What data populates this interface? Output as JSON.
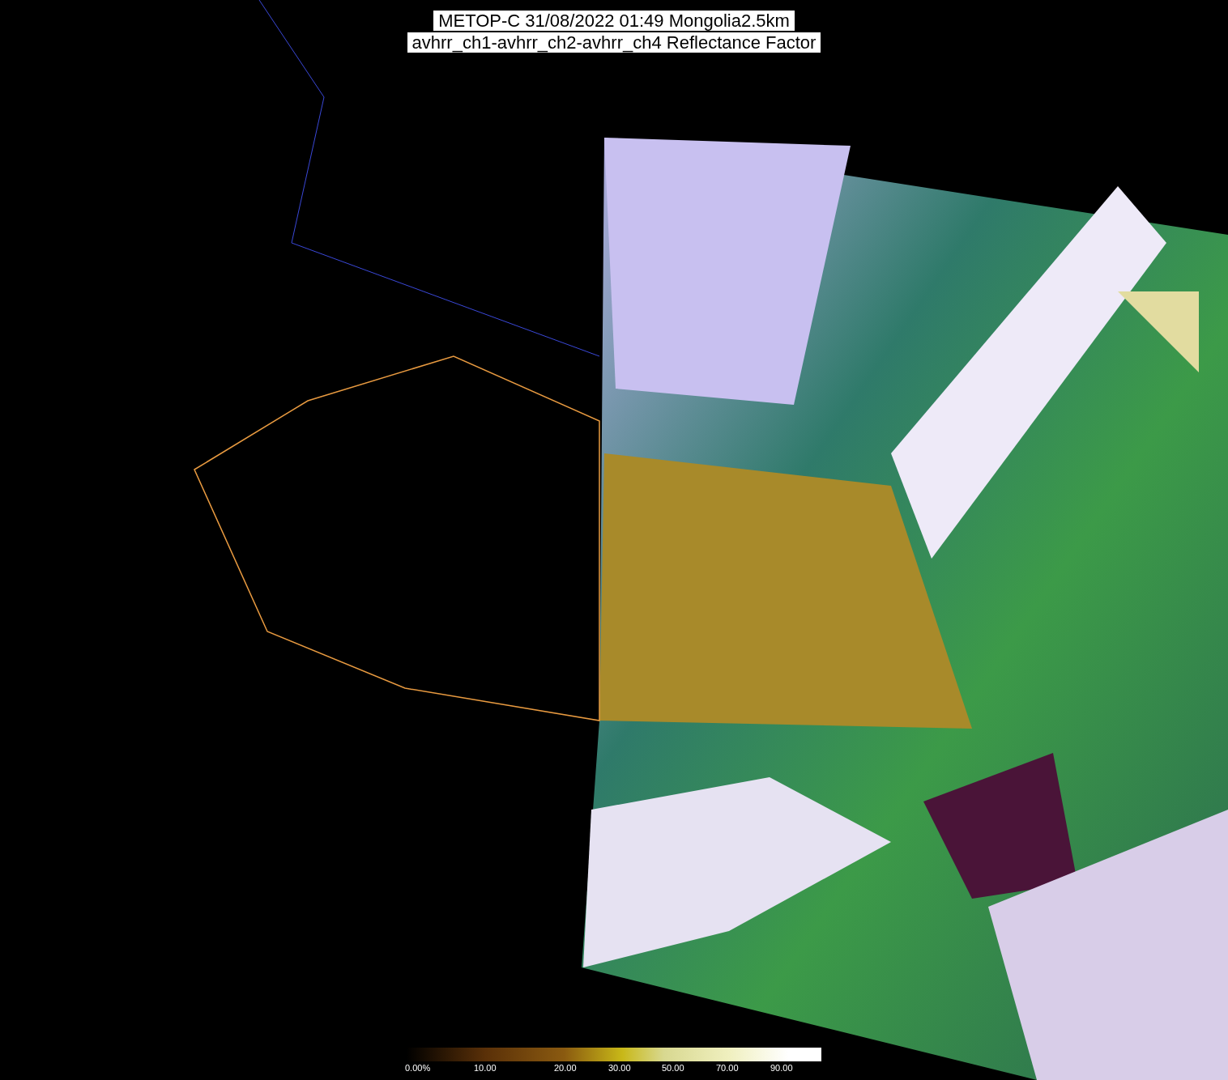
{
  "title": {
    "lines": [
      "METOP-C 31/08/2022 01:49 Mongolia2.5km",
      "avhrr_ch1-avhrr_ch2-avhrr_ch4 Reflectance Factor"
    ]
  },
  "colorbar": {
    "labels": [
      "0.00%",
      "10.00",
      "20.00",
      "30.00",
      "50.00",
      "70.00",
      "90.00"
    ]
  }
}
